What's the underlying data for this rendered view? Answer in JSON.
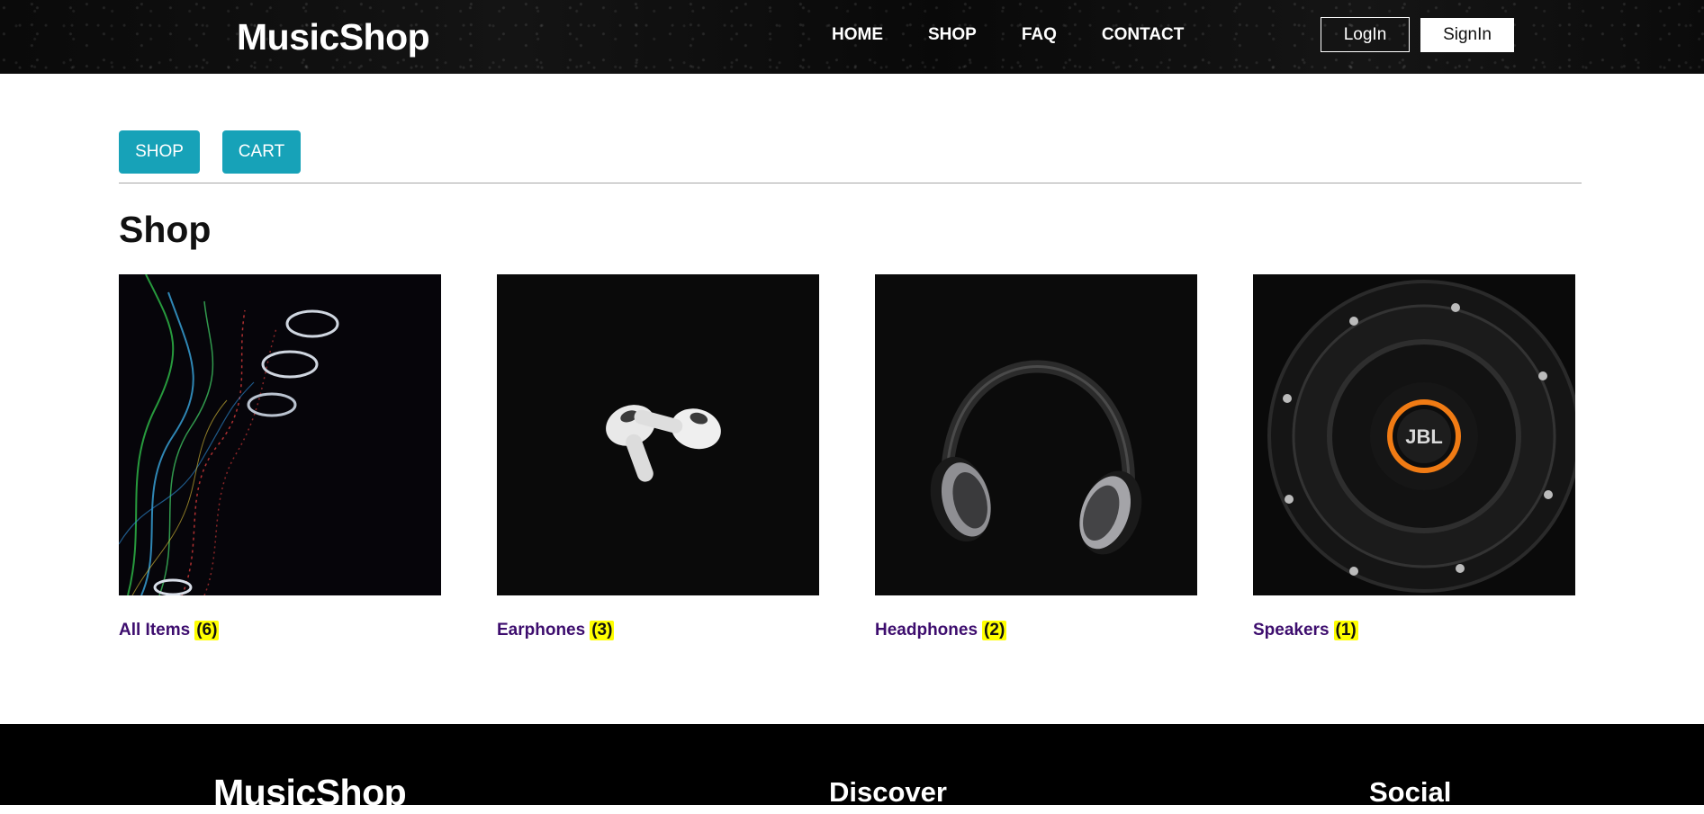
{
  "header": {
    "brand": "MusicShop",
    "nav": [
      "HOME",
      "SHOP",
      "FAQ",
      "CONTACT"
    ],
    "login_label": "LogIn",
    "signin_label": "SignIn"
  },
  "tabs": {
    "shop_label": "SHOP",
    "cart_label": "CART"
  },
  "page": {
    "title": "Shop"
  },
  "categories": [
    {
      "name": "All Items",
      "count": "6",
      "image": "light-trails-image"
    },
    {
      "name": "Earphones",
      "count": "3",
      "image": "earbuds-image"
    },
    {
      "name": "Headphones",
      "count": "2",
      "image": "headphones-image"
    },
    {
      "name": "Speakers",
      "count": "1",
      "image": "speaker-image"
    }
  ],
  "footer": {
    "brand": "MusicShop",
    "discover_heading": "Discover",
    "social_heading": "Social"
  },
  "colors": {
    "header_bg": "#050505",
    "tab_button": "#17a2b8",
    "category_link": "#3d0d6e",
    "count_highlight": "#ffff00",
    "footer_bg": "#000000"
  }
}
